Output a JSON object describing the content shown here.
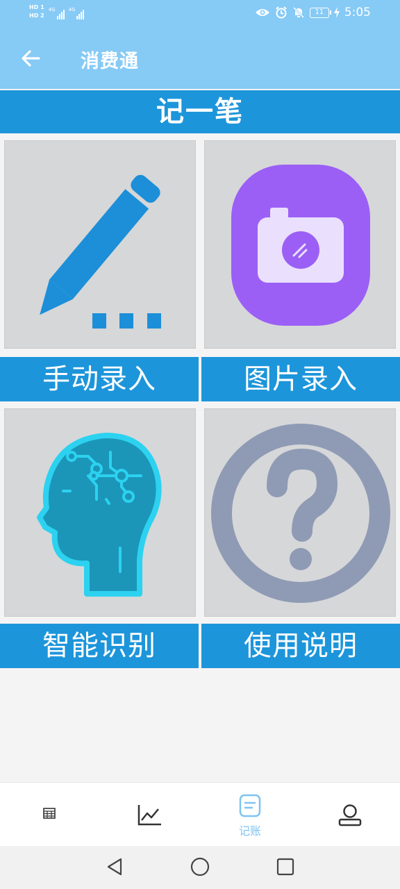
{
  "status_bar": {
    "hd1": "HD 1",
    "hd2": "HD 2",
    "net1": "4G",
    "net2": "4G",
    "battery": "11",
    "time": "5:05"
  },
  "app_bar": {
    "title": "消费通"
  },
  "section": {
    "title": "记一笔"
  },
  "tiles": [
    {
      "label": "手动录入",
      "icon": "pencil-icon"
    },
    {
      "label": "图片录入",
      "icon": "camera-icon"
    },
    {
      "label": "智能识别",
      "icon": "ai-head-icon"
    },
    {
      "label": "使用说明",
      "icon": "question-icon"
    }
  ],
  "bottom_nav": {
    "items": [
      {
        "label": "",
        "icon": "calendar-icon"
      },
      {
        "label": "",
        "icon": "chart-icon"
      },
      {
        "label": "记账",
        "icon": "note-icon",
        "active": true
      },
      {
        "label": "",
        "icon": "user-icon"
      }
    ]
  },
  "colors": {
    "status_bar": "#86caf6",
    "accent": "#1d95da",
    "tile_bg": "#d6d7d9",
    "camera_purple": "#9b5ff6",
    "question_gray": "#8f9bb4",
    "active_nav": "#7ec3ef"
  }
}
